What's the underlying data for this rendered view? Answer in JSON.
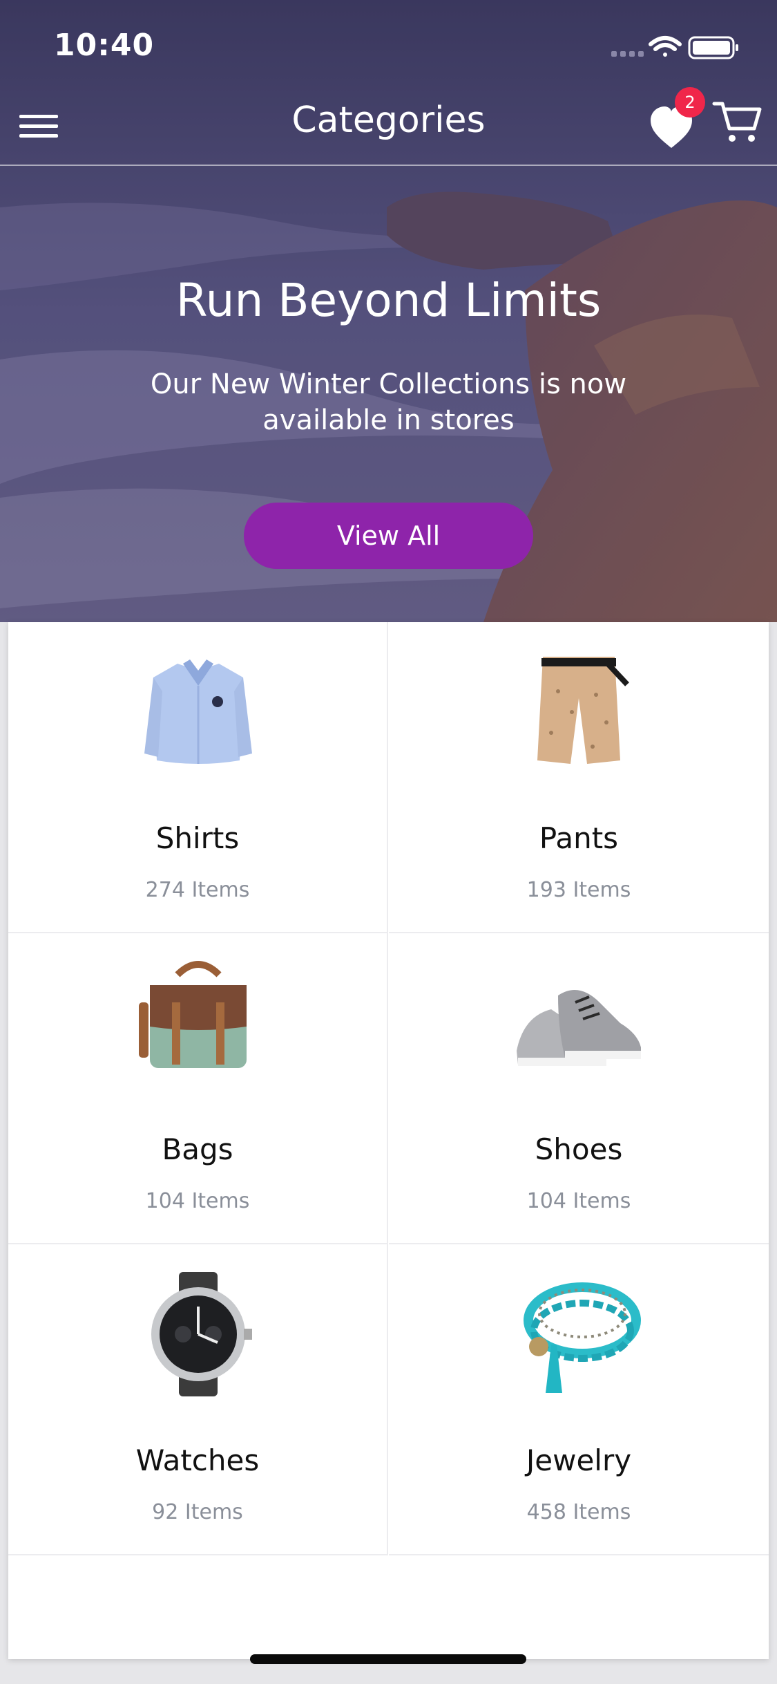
{
  "status_bar": {
    "time": "10:40"
  },
  "navbar": {
    "title": "Categories",
    "favorites_badge": "2"
  },
  "hero": {
    "title": "Run Beyond Limits",
    "subtitle": "Our New Winter Collections is now available in stores",
    "button_label": "View All"
  },
  "categories": [
    {
      "name": "Shirts",
      "count": "274 Items",
      "icon": "shirt-icon"
    },
    {
      "name": "Pants",
      "count": "193 Items",
      "icon": "pants-icon"
    },
    {
      "name": "Bags",
      "count": "104 Items",
      "icon": "bag-icon"
    },
    {
      "name": "Shoes",
      "count": "104 Items",
      "icon": "shoe-icon"
    },
    {
      "name": "Watches",
      "count": "92 Items",
      "icon": "watch-icon"
    },
    {
      "name": "Jewelry",
      "count": "458 Items",
      "icon": "bracelet-icon"
    }
  ],
  "colors": {
    "accent": "#8e24aa",
    "badge": "#f0264a",
    "hero_overlay": "#4a4670",
    "muted_text": "#8a8f99"
  }
}
